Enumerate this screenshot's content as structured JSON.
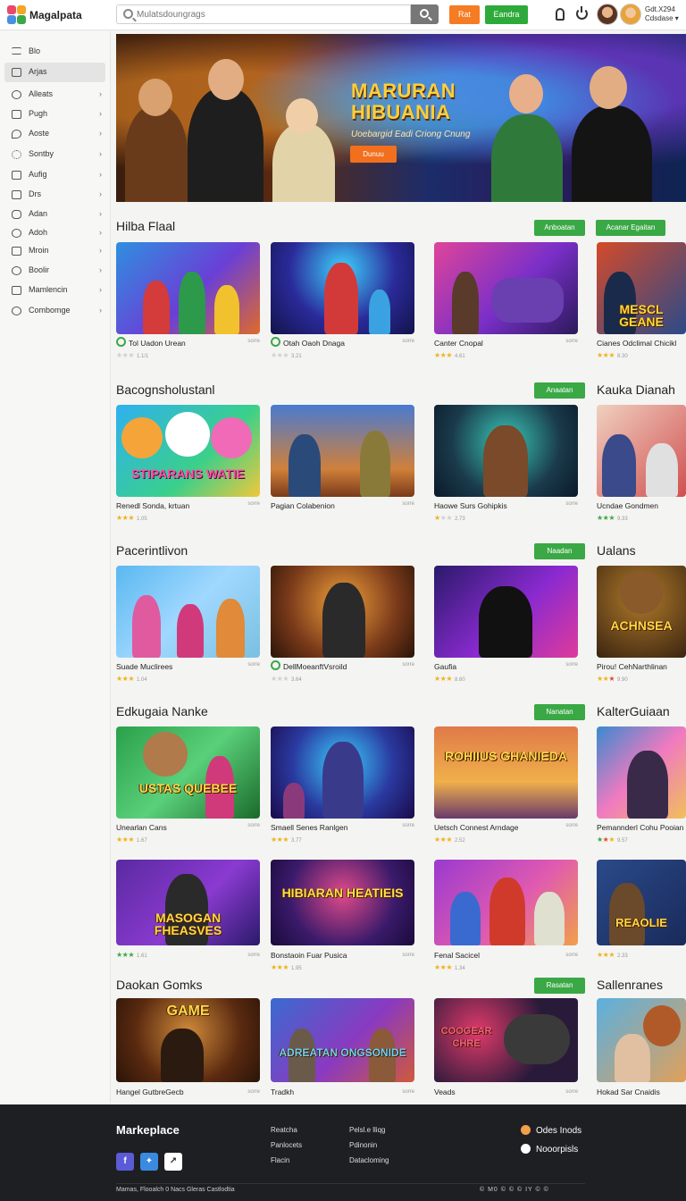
{
  "header": {
    "brand": "Magalpata",
    "search_placeholder": "Mulatsdoungrags",
    "btn_orange": "Rat",
    "btn_green": "Eandra",
    "user_name_line1": "Gdt.X294",
    "user_name_line2": "Cdsdase ▾"
  },
  "sidebar": {
    "items": [
      {
        "label": "Blo",
        "icon": "list-icon",
        "chev": ""
      },
      {
        "label": "Arjas",
        "icon": "square-icon",
        "chev": ""
      },
      {
        "label": "Alleats",
        "icon": "circle-icon",
        "chev": "›"
      },
      {
        "label": "Pugh",
        "icon": "box-icon",
        "chev": "›"
      },
      {
        "label": "Aoste",
        "icon": "tag-icon",
        "chev": "›"
      },
      {
        "label": "Sontby",
        "icon": "gear-icon",
        "chev": "›"
      },
      {
        "label": "Aufig",
        "icon": "box-icon",
        "chev": "›"
      },
      {
        "label": "Drs",
        "icon": "doc-icon",
        "chev": "›"
      },
      {
        "label": "Adan",
        "icon": "box-icon",
        "chev": "›"
      },
      {
        "label": "Adoh",
        "icon": "clock-icon",
        "chev": "›"
      },
      {
        "label": "Mroin",
        "icon": "box-icon",
        "chev": "›"
      },
      {
        "label": "Boolir",
        "icon": "circle-icon",
        "chev": "›"
      },
      {
        "label": "Mamlencin",
        "icon": "box-icon",
        "chev": "›"
      },
      {
        "label": "Combomge",
        "icon": "circle-icon",
        "chev": "›"
      }
    ]
  },
  "hero": {
    "title_line1": "MARURAN",
    "title_line2": "HIBUANIA",
    "subtitle": "Uoebargid Eadi Criong Cnung",
    "button": "Dunuu"
  },
  "sections": [
    {
      "title": "Hilba Flaal",
      "btn1": "Anboatan",
      "btn2": "Acanar Egaitan",
      "right_title": "",
      "cards": [
        {
          "title": "Tol Uadon Urean",
          "meta": "sorre",
          "stars": 0,
          "rating": "1.1/1",
          "icon": true,
          "word": ""
        },
        {
          "title": "Otah Oaoh Dnaga",
          "meta": "sorre",
          "stars": 0,
          "rating": "3.21",
          "icon": true,
          "word": ""
        },
        {
          "title": "Canter Cnopal",
          "meta": "sorre",
          "stars": 3,
          "rating": "4.61",
          "icon": false,
          "word": ""
        },
        {
          "title": "Cianes Odclimal Chicikl",
          "meta": "",
          "stars": 4,
          "rating": "8.30",
          "icon": false,
          "word": "MESCL GEANE"
        }
      ]
    },
    {
      "title": "Bacognsholustanl",
      "btn1": "Anaatan",
      "btn2": "",
      "right_title": "Kauka Dianah",
      "cards": [
        {
          "title": "Renedl Sonda, krtuan",
          "meta": "sorre",
          "stars": 3,
          "rating": "1.05",
          "icon": false,
          "word": "STIPARANS WATIE"
        },
        {
          "title": "Pagian Colabenion",
          "meta": "sorre",
          "stars": 0,
          "rating": "",
          "icon": false,
          "word": ""
        },
        {
          "title": "Haowe Surs Gohipkis",
          "meta": "sorre",
          "stars": 1,
          "rating": "2.73",
          "icon": false,
          "word": ""
        },
        {
          "title": "Ucndae Gondmen",
          "meta": "",
          "stars": 3,
          "rating": "9.33",
          "icon": false,
          "word": ""
        }
      ]
    },
    {
      "title": "Pacerintlivon",
      "btn1": "Naadan",
      "btn2": "",
      "right_title": "Ualans",
      "cards": [
        {
          "title": "Suade Muclirees",
          "meta": "sorre",
          "stars": 3,
          "rating": "1.04",
          "icon": false,
          "word": ""
        },
        {
          "title": "DellMoeanftVsroild",
          "meta": "sorre",
          "stars": 0,
          "rating": "3.64",
          "icon": true,
          "word": ""
        },
        {
          "title": "Gaufia",
          "meta": "sorre",
          "stars": 3,
          "rating": "8.60",
          "icon": false,
          "word": ""
        },
        {
          "title": "Pirou! CehNarthlinan",
          "meta": "",
          "stars": 3,
          "rating": "9.90",
          "icon": false,
          "word": "ACHNSEA"
        }
      ]
    },
    {
      "title": "Edkugaia Nanke",
      "btn1": "Nanatan",
      "btn2": "",
      "right_title": "KalterGuiaan",
      "cards": [
        {
          "title": "Unearlan Cans",
          "meta": "sorre",
          "stars": 3,
          "rating": "1.67",
          "icon": false,
          "word": "USTAS QUEBEE"
        },
        {
          "title": "Smaell Senes Ranlgen",
          "meta": "sorre",
          "stars": 3,
          "rating": "3.77",
          "icon": false,
          "word": ""
        },
        {
          "title": "Uetsch Connest Arndage",
          "meta": "sorre",
          "stars": 3,
          "rating": "2.52",
          "icon": false,
          "word": "ROHIIUS GHANIEDA"
        },
        {
          "title": "Pemannderl Cohu Pooian",
          "meta": "",
          "stars": 3,
          "rating": "9.57",
          "icon": false,
          "word": ""
        }
      ]
    },
    {
      "title": "",
      "btn1": "",
      "btn2": "",
      "right_title": "",
      "cards": [
        {
          "title": "",
          "meta": "sorre",
          "stars": 3,
          "rating": "1.61",
          "icon": false,
          "word": "MASOGAN FHEASVES"
        },
        {
          "title": "Bonstaoin Fuar Pusica",
          "meta": "sorre",
          "stars": 3,
          "rating": "1.95",
          "icon": false,
          "word": "HIBIARAN HEATIEIS"
        },
        {
          "title": "Fenal Sacicel",
          "meta": "sorre",
          "stars": 3,
          "rating": "1.34",
          "icon": false,
          "word": ""
        },
        {
          "title": "",
          "meta": "",
          "stars": 3,
          "rating": "2.33",
          "icon": false,
          "word": "REAOLIE"
        }
      ]
    },
    {
      "title": "Daokan Gomks",
      "btn1": "Rasatan",
      "btn2": "",
      "right_title": "Sallenranes",
      "cards": [
        {
          "title": "Hangel GutbreGecb",
          "meta": "sorre",
          "stars": 0,
          "rating": "",
          "icon": false,
          "word": "GAME"
        },
        {
          "title": "Tradkh",
          "meta": "sorre",
          "stars": 0,
          "rating": "",
          "icon": false,
          "word": "ADREATAN ONGSONIDE"
        },
        {
          "title": "Veads",
          "meta": "sorre",
          "stars": 0,
          "rating": "",
          "icon": false,
          "word": "COOGEAR CHRE"
        },
        {
          "title": "Hokad Sar Cnaidis",
          "meta": "",
          "stars": 0,
          "rating": "",
          "icon": false,
          "word": ""
        }
      ]
    }
  ],
  "footer": {
    "brand": "Markeplace",
    "col1": [
      "Reatcha",
      "Panlocets",
      "Flacin"
    ],
    "col2": [
      "Pelsl.e lliqg",
      "Pdinonin",
      "Datacloming"
    ],
    "app1": "Odes Inods",
    "app2": "Nooorpisls",
    "copyright": "Mamas, Flooalch 0 Nacs Gleras Castlodtia",
    "bottom_icons": "© M0 © © © IY © ©"
  },
  "colors": {
    "accent_orange": "#f57c22",
    "accent_green": "#2eaa3a",
    "footer_bg": "#1e1f22"
  }
}
